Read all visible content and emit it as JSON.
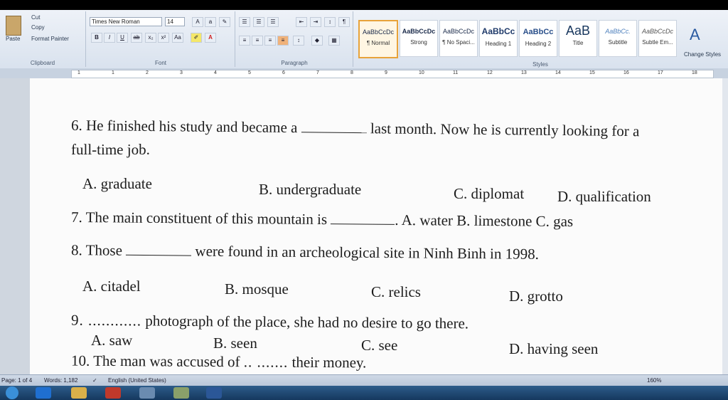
{
  "ribbon": {
    "clipboard": {
      "paste": "Paste",
      "cut": "Cut",
      "copy": "Copy",
      "format_painter": "Format Painter",
      "label": "Clipboard"
    },
    "font": {
      "font_name": "Times New Roman",
      "font_size": "14",
      "label": "Font"
    },
    "paragraph": {
      "label": "Paragraph"
    },
    "styles": {
      "label": "Styles",
      "tiles": [
        {
          "preview": "AaBbCcDc",
          "name": "¶ Normal"
        },
        {
          "preview": "AaBbCcDc",
          "name": "Strong"
        },
        {
          "preview": "AaBbCcDc",
          "name": "¶ No Spaci..."
        },
        {
          "preview": "AaBbCc",
          "name": "Heading 1"
        },
        {
          "preview": "AaBbCc",
          "name": "Heading 2"
        },
        {
          "preview": "AaB",
          "name": "Title"
        },
        {
          "preview": "AaBbCc.",
          "name": "Subtitle"
        },
        {
          "preview": "AaBbCcDc",
          "name": "Subtle Em..."
        }
      ],
      "change_styles": "Change Styles"
    }
  },
  "ruler": {
    "numbers": [
      "1",
      "1",
      "2",
      "3",
      "4",
      "5",
      "6",
      "7",
      "8",
      "9",
      "10",
      "11",
      "12",
      "13",
      "14",
      "15",
      "16",
      "17",
      "18"
    ]
  },
  "document": {
    "q6": {
      "before": "6. He finished his study and became a",
      "after": "last month. Now he is currently looking for a",
      "line2": "full-time job.",
      "options": [
        "A. graduate",
        "B. undergraduate",
        "C. diplomat",
        "D. qualification"
      ]
    },
    "q7": {
      "before": "7. The main constituent of this mountain is",
      "after": ". A. water B. limestone C. gas"
    },
    "q8": {
      "before": "8. Those",
      "after": "were found in an archeological site in Ninh Binh in 1998.",
      "options": [
        "A. citadel",
        "B. mosque",
        "C. relics",
        "D. grotto"
      ]
    },
    "q9": {
      "dots": "9. ............",
      "after": "photograph of the place, she had no desire to go there.",
      "options": [
        "A. saw",
        "B. seen",
        "C. see",
        "D. having seen"
      ]
    },
    "q10": {
      "before": "10. The man was accused of",
      "dots": ".. .......",
      "after": "their money."
    }
  },
  "status": {
    "page": "Page: 1 of 4",
    "words": "Words: 1,182",
    "language": "English (United States)",
    "zoom": "160%"
  }
}
